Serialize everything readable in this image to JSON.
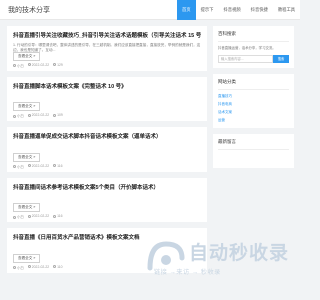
{
  "site": {
    "title": "我的技术分享"
  },
  "nav": [
    {
      "label": "首页",
      "active": true
    },
    {
      "label": "提示下"
    },
    {
      "label": "抖音视频"
    },
    {
      "label": "抖音快捷"
    },
    {
      "label": "教程工具"
    }
  ],
  "posts": [
    {
      "title": "抖音直播引导关注收藏技巧_抖音引导关注话术话题模板（引导关注话术 15 号）",
      "excerpt": "1. 行动的引导：哪里请去吧，整体讲述的是引导，在三越机制。我们应该直接把直接，直接放完，举例的就是我们，这边，我也是知道了。互动...",
      "more": "查看全文 »",
      "author": "小白",
      "date": "2022-02-22",
      "views": "129"
    },
    {
      "title": "抖音直播脚本话术模板文案《完整话术 10 号》",
      "excerpt": "",
      "more": "查看全文 »",
      "author": "小白",
      "date": "2022-02-22",
      "views": "109"
    },
    {
      "title": "抖音直播逼单促成交话术脚本抖音话术模板文案（逼单话术）",
      "excerpt": "",
      "more": "查看全文 »",
      "author": "小白",
      "date": "2022-02-22",
      "views": "116"
    },
    {
      "title": "抖音直播间话术参考话术模板文案5个类目（开价脚本话术）",
      "excerpt": "",
      "more": "查看全文 »",
      "author": "小白",
      "date": "2022-02-22",
      "views": "116"
    },
    {
      "title": "抖音直播《日用百货水产品营销话术》模板文案文档",
      "excerpt": "",
      "more": "查看全文 »",
      "author": "小白",
      "date": "2022-02-22",
      "views": "110"
    }
  ],
  "sidebar": {
    "search_widget": {
      "title": "百科搜索",
      "text": "抖音直播运营，话术分享，学习交流。",
      "placeholder": "输入搜索内容...",
      "button": "搜索"
    },
    "category_widget": {
      "title": "网站分类",
      "items": [
        "直播技巧",
        "抖音电商",
        "话术文案",
        "运营"
      ]
    },
    "recent_widget": {
      "title": "最新留言",
      "text": ""
    }
  },
  "watermark": {
    "title": "自动秒收录",
    "subtitle": "链接 →来访 → 秒收录",
    "brand_color": "#c9d6e3"
  }
}
